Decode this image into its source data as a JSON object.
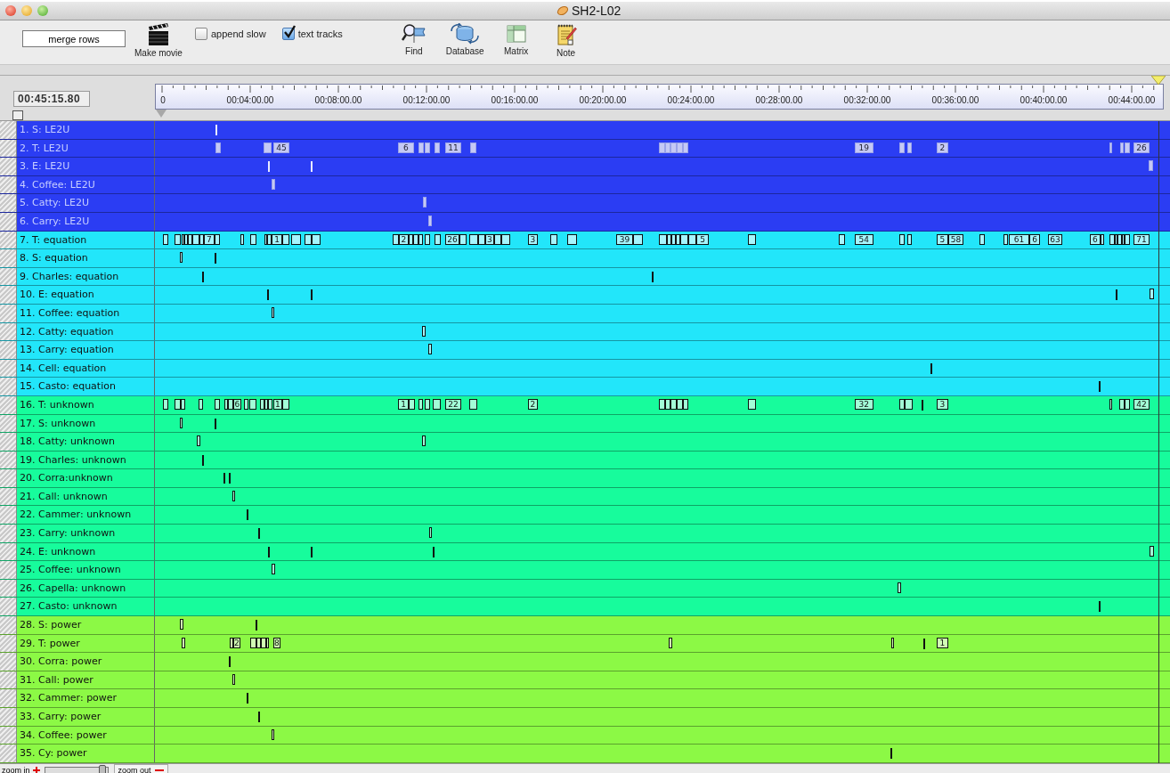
{
  "window": {
    "title": "SH2-L02"
  },
  "toolbar": {
    "merge_button": "merge rows",
    "make_movie": "Make movie",
    "checkboxes": [
      {
        "label": "append slow",
        "checked": false
      },
      {
        "label": "text tracks",
        "checked": true
      }
    ],
    "tools": [
      {
        "label": "Find",
        "kind": "find"
      },
      {
        "label": "Database",
        "kind": "database"
      },
      {
        "label": "Matrix",
        "kind": "matrix"
      },
      {
        "label": "Note",
        "kind": "note"
      }
    ]
  },
  "timecode": "00:45:15.80",
  "select_all": {
    "checked": false
  },
  "ruler": {
    "labels": [
      "0",
      "00:04:00.00",
      "00:08:00.00",
      "00:12:00.00",
      "00:16:00.00",
      "00:20:00.00",
      "00:24:00.00",
      "00:28:00.00",
      "00:32:00.00",
      "00:36:00.00",
      "00:40:00.00",
      "00:44:00.00"
    ]
  },
  "tracks": [
    {
      "name": "1. S: LE2U",
      "color": "#2b3df3",
      "dark": true,
      "events": [
        {
          "kind": "tick"
        }
      ]
    },
    {
      "name": "2. T: LE2U",
      "color": "#2b3df3",
      "dark": true,
      "events": [
        {
          "kind": "box"
        },
        {
          "kind": "box"
        },
        {
          "kind": "box",
          "label": "45"
        },
        {
          "kind": "box",
          "label": "6"
        },
        {
          "kind": "box"
        },
        {
          "kind": "box"
        },
        {
          "kind": "box"
        },
        {
          "kind": "box",
          "label": "11"
        },
        {
          "kind": "box"
        },
        {
          "kind": "box"
        },
        {
          "kind": "box"
        },
        {
          "kind": "box"
        },
        {
          "kind": "box"
        },
        {
          "kind": "box"
        },
        {
          "kind": "box",
          "label": "19"
        },
        {
          "kind": "box"
        },
        {
          "kind": "box"
        },
        {
          "kind": "box",
          "label": "2"
        },
        {
          "kind": "box"
        },
        {
          "kind": "box"
        },
        {
          "kind": "box"
        },
        {
          "kind": "box",
          "label": "26"
        }
      ]
    },
    {
      "name": "3. E: LE2U",
      "color": "#2b3df3",
      "dark": true,
      "events": [
        {
          "kind": "tick"
        },
        {
          "kind": "tick"
        },
        {
          "kind": "box"
        }
      ]
    },
    {
      "name": "4. Coffee: LE2U",
      "color": "#2b3df3",
      "dark": true,
      "events": [
        {
          "kind": "box"
        }
      ]
    },
    {
      "name": "5. Catty: LE2U",
      "color": "#2b3df3",
      "dark": true,
      "events": [
        {
          "kind": "box"
        }
      ]
    },
    {
      "name": "6. Carry: LE2U",
      "color": "#2b3df3",
      "dark": true,
      "events": [
        {
          "kind": "box"
        }
      ]
    },
    {
      "name": "7. T: equation",
      "color": "#22e6fa",
      "dark": false,
      "events": [
        {
          "kind": "box"
        },
        {
          "kind": "box"
        },
        {
          "kind": "box"
        },
        {
          "kind": "box"
        },
        {
          "kind": "box"
        },
        {
          "kind": "box"
        },
        {
          "kind": "box"
        },
        {
          "kind": "box",
          "label": "7"
        },
        {
          "kind": "box"
        },
        {
          "kind": "box"
        },
        {
          "kind": "box"
        },
        {
          "kind": "box"
        },
        {
          "kind": "box"
        },
        {
          "kind": "box",
          "label": "1"
        },
        {
          "kind": "box"
        },
        {
          "kind": "box"
        },
        {
          "kind": "box"
        },
        {
          "kind": "box"
        },
        {
          "kind": "box"
        },
        {
          "kind": "box",
          "label": "2"
        },
        {
          "kind": "box"
        },
        {
          "kind": "box"
        },
        {
          "kind": "box"
        },
        {
          "kind": "box"
        },
        {
          "kind": "box"
        },
        {
          "kind": "box",
          "label": "26"
        },
        {
          "kind": "box"
        },
        {
          "kind": "box"
        },
        {
          "kind": "box"
        },
        {
          "kind": "box",
          "label": "3"
        },
        {
          "kind": "box"
        },
        {
          "kind": "box"
        },
        {
          "kind": "box",
          "label": "3"
        },
        {
          "kind": "box"
        },
        {
          "kind": "box"
        },
        {
          "kind": "box",
          "label": "39"
        },
        {
          "kind": "box"
        },
        {
          "kind": "box"
        },
        {
          "kind": "box"
        },
        {
          "kind": "box"
        },
        {
          "kind": "box"
        },
        {
          "kind": "box"
        },
        {
          "kind": "box"
        },
        {
          "kind": "box",
          "label": "5"
        },
        {
          "kind": "box"
        },
        {
          "kind": "box"
        },
        {
          "kind": "box",
          "label": "54"
        },
        {
          "kind": "box"
        },
        {
          "kind": "box"
        },
        {
          "kind": "box",
          "label": "5"
        },
        {
          "kind": "box",
          "label": "58"
        },
        {
          "kind": "box"
        },
        {
          "kind": "box"
        },
        {
          "kind": "box",
          "label": "61"
        },
        {
          "kind": "box",
          "label": "6"
        },
        {
          "kind": "box",
          "label": "63"
        },
        {
          "kind": "box",
          "label": "6"
        },
        {
          "kind": "box"
        },
        {
          "kind": "box"
        },
        {
          "kind": "box"
        },
        {
          "kind": "box"
        },
        {
          "kind": "box"
        },
        {
          "kind": "box"
        },
        {
          "kind": "box",
          "label": "71"
        }
      ]
    },
    {
      "name": "8. S: equation",
      "color": "#22e6fa",
      "dark": false,
      "events": [
        {
          "kind": "box"
        },
        {
          "kind": "tick"
        }
      ]
    },
    {
      "name": "9. Charles: equation",
      "color": "#22e6fa",
      "dark": false,
      "events": [
        {
          "kind": "tick"
        },
        {
          "kind": "tick"
        }
      ]
    },
    {
      "name": "10. E: equation",
      "color": "#22e6fa",
      "dark": false,
      "events": [
        {
          "kind": "tick"
        },
        {
          "kind": "tick"
        },
        {
          "kind": "tick"
        },
        {
          "kind": "box"
        }
      ]
    },
    {
      "name": "11. Coffee: equation",
      "color": "#22e6fa",
      "dark": false,
      "events": [
        {
          "kind": "box"
        }
      ]
    },
    {
      "name": "12. Catty: equation",
      "color": "#22e6fa",
      "dark": false,
      "events": [
        {
          "kind": "box"
        }
      ]
    },
    {
      "name": "13. Carry: equation",
      "color": "#22e6fa",
      "dark": false,
      "events": [
        {
          "kind": "box"
        }
      ]
    },
    {
      "name": "14. Cell: equation",
      "color": "#22e6fa",
      "dark": false,
      "events": [
        {
          "kind": "tick"
        }
      ]
    },
    {
      "name": "15. Casto: equation",
      "color": "#22e6fa",
      "dark": false,
      "events": [
        {
          "kind": "tick"
        }
      ]
    },
    {
      "name": "16. T: unknown",
      "color": "#17fc9c",
      "dark": false,
      "events": [
        {
          "kind": "box"
        },
        {
          "kind": "box"
        },
        {
          "kind": "box"
        },
        {
          "kind": "box"
        },
        {
          "kind": "box"
        },
        {
          "kind": "box"
        },
        {
          "kind": "box"
        },
        {
          "kind": "box",
          "label": "6"
        },
        {
          "kind": "box"
        },
        {
          "kind": "box"
        },
        {
          "kind": "box"
        },
        {
          "kind": "box"
        },
        {
          "kind": "box"
        },
        {
          "kind": "box",
          "label": "1"
        },
        {
          "kind": "box"
        },
        {
          "kind": "box",
          "label": "1"
        },
        {
          "kind": "box"
        },
        {
          "kind": "box"
        },
        {
          "kind": "box"
        },
        {
          "kind": "box"
        },
        {
          "kind": "box",
          "label": "22"
        },
        {
          "kind": "box"
        },
        {
          "kind": "box",
          "label": "2"
        },
        {
          "kind": "box"
        },
        {
          "kind": "box"
        },
        {
          "kind": "box"
        },
        {
          "kind": "box"
        },
        {
          "kind": "box"
        },
        {
          "kind": "box"
        },
        {
          "kind": "box",
          "label": "32"
        },
        {
          "kind": "box"
        },
        {
          "kind": "box"
        },
        {
          "kind": "tick"
        },
        {
          "kind": "box",
          "label": "3"
        },
        {
          "kind": "box"
        },
        {
          "kind": "box"
        },
        {
          "kind": "box"
        },
        {
          "kind": "box",
          "label": "42"
        }
      ]
    },
    {
      "name": "17. S: unknown",
      "color": "#17fc9c",
      "dark": false,
      "events": [
        {
          "kind": "box"
        },
        {
          "kind": "tick"
        }
      ]
    },
    {
      "name": "18. Catty: unknown",
      "color": "#17fc9c",
      "dark": false,
      "events": [
        {
          "kind": "box"
        },
        {
          "kind": "box"
        }
      ]
    },
    {
      "name": "19. Charles: unknown",
      "color": "#17fc9c",
      "dark": false,
      "events": [
        {
          "kind": "tick"
        }
      ]
    },
    {
      "name": "20. Corra:unknown",
      "color": "#17fc9c",
      "dark": false,
      "events": [
        {
          "kind": "tick"
        },
        {
          "kind": "tick"
        }
      ]
    },
    {
      "name": "21. Call: unknown",
      "color": "#17fc9c",
      "dark": false,
      "events": [
        {
          "kind": "box"
        }
      ]
    },
    {
      "name": "22. Cammer: unknown",
      "color": "#17fc9c",
      "dark": false,
      "events": [
        {
          "kind": "tick"
        }
      ]
    },
    {
      "name": "23. Carry: unknown",
      "color": "#17fc9c",
      "dark": false,
      "events": [
        {
          "kind": "tick"
        },
        {
          "kind": "box"
        }
      ]
    },
    {
      "name": "24. E: unknown",
      "color": "#17fc9c",
      "dark": false,
      "events": [
        {
          "kind": "tick"
        },
        {
          "kind": "tick"
        },
        {
          "kind": "tick"
        },
        {
          "kind": "box"
        }
      ]
    },
    {
      "name": "25. Coffee: unknown",
      "color": "#17fc9c",
      "dark": false,
      "events": [
        {
          "kind": "box"
        }
      ]
    },
    {
      "name": "26. Capella: unknown",
      "color": "#17fc9c",
      "dark": false,
      "events": [
        {
          "kind": "box"
        }
      ]
    },
    {
      "name": "27. Casto: unknown",
      "color": "#17fc9c",
      "dark": false,
      "events": [
        {
          "kind": "tick"
        }
      ]
    },
    {
      "name": "28. S: power",
      "color": "#8cf945",
      "dark": false,
      "events": [
        {
          "kind": "box"
        },
        {
          "kind": "tick"
        }
      ]
    },
    {
      "name": "29. T: power",
      "color": "#8cf945",
      "dark": false,
      "events": [
        {
          "kind": "box"
        },
        {
          "kind": "box"
        },
        {
          "kind": "box",
          "label": "2"
        },
        {
          "kind": "box"
        },
        {
          "kind": "box"
        },
        {
          "kind": "box"
        },
        {
          "kind": "box"
        },
        {
          "kind": "box",
          "label": "8"
        },
        {
          "kind": "box"
        },
        {
          "kind": "box"
        },
        {
          "kind": "tick"
        },
        {
          "kind": "box",
          "label": "1"
        }
      ]
    },
    {
      "name": "30. Corra: power",
      "color": "#8cf945",
      "dark": false,
      "events": [
        {
          "kind": "tick"
        }
      ]
    },
    {
      "name": "31. Call: power",
      "color": "#8cf945",
      "dark": false,
      "events": [
        {
          "kind": "box"
        }
      ]
    },
    {
      "name": "32. Cammer: power",
      "color": "#8cf945",
      "dark": false,
      "events": [
        {
          "kind": "tick"
        }
      ]
    },
    {
      "name": "33. Carry: power",
      "color": "#8cf945",
      "dark": false,
      "events": [
        {
          "kind": "tick"
        }
      ]
    },
    {
      "name": "34. Coffee: power",
      "color": "#8cf945",
      "dark": false,
      "events": [
        {
          "kind": "box"
        }
      ]
    },
    {
      "name": "35. Cy: power",
      "color": "#8cf945",
      "dark": false,
      "events": [
        {
          "kind": "tick"
        }
      ]
    }
  ],
  "zoom": {
    "zoom_in": "zoom in",
    "zoom_out": "zoom out",
    "level": 0.93
  }
}
